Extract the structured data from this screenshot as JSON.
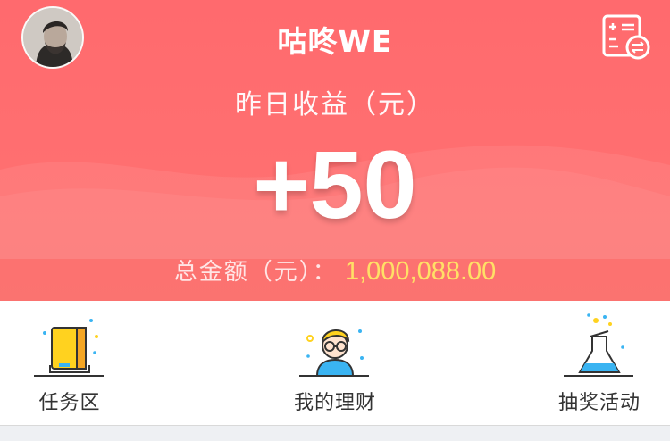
{
  "header": {
    "title": "咕咚WE",
    "avatar_icon": "user-avatar",
    "action_icon": "ledger-exchange-icon"
  },
  "earnings": {
    "yesterday_label": "昨日收益（元）",
    "yesterday_value": "+50",
    "total_label": "总金额（元）：",
    "total_value": "1,000,088.00"
  },
  "menu": {
    "items": [
      {
        "label": "任务区",
        "icon": "book-task-icon"
      },
      {
        "label": "我的理财",
        "icon": "person-glasses-icon"
      },
      {
        "label": "抽奖活动",
        "icon": "flask-lottery-icon"
      }
    ]
  },
  "colors": {
    "hero_red": "#ff6a6e",
    "gold_amount": "#ffe066",
    "icon_yellow": "#ffd21f",
    "icon_blue": "#3ab4f2"
  }
}
